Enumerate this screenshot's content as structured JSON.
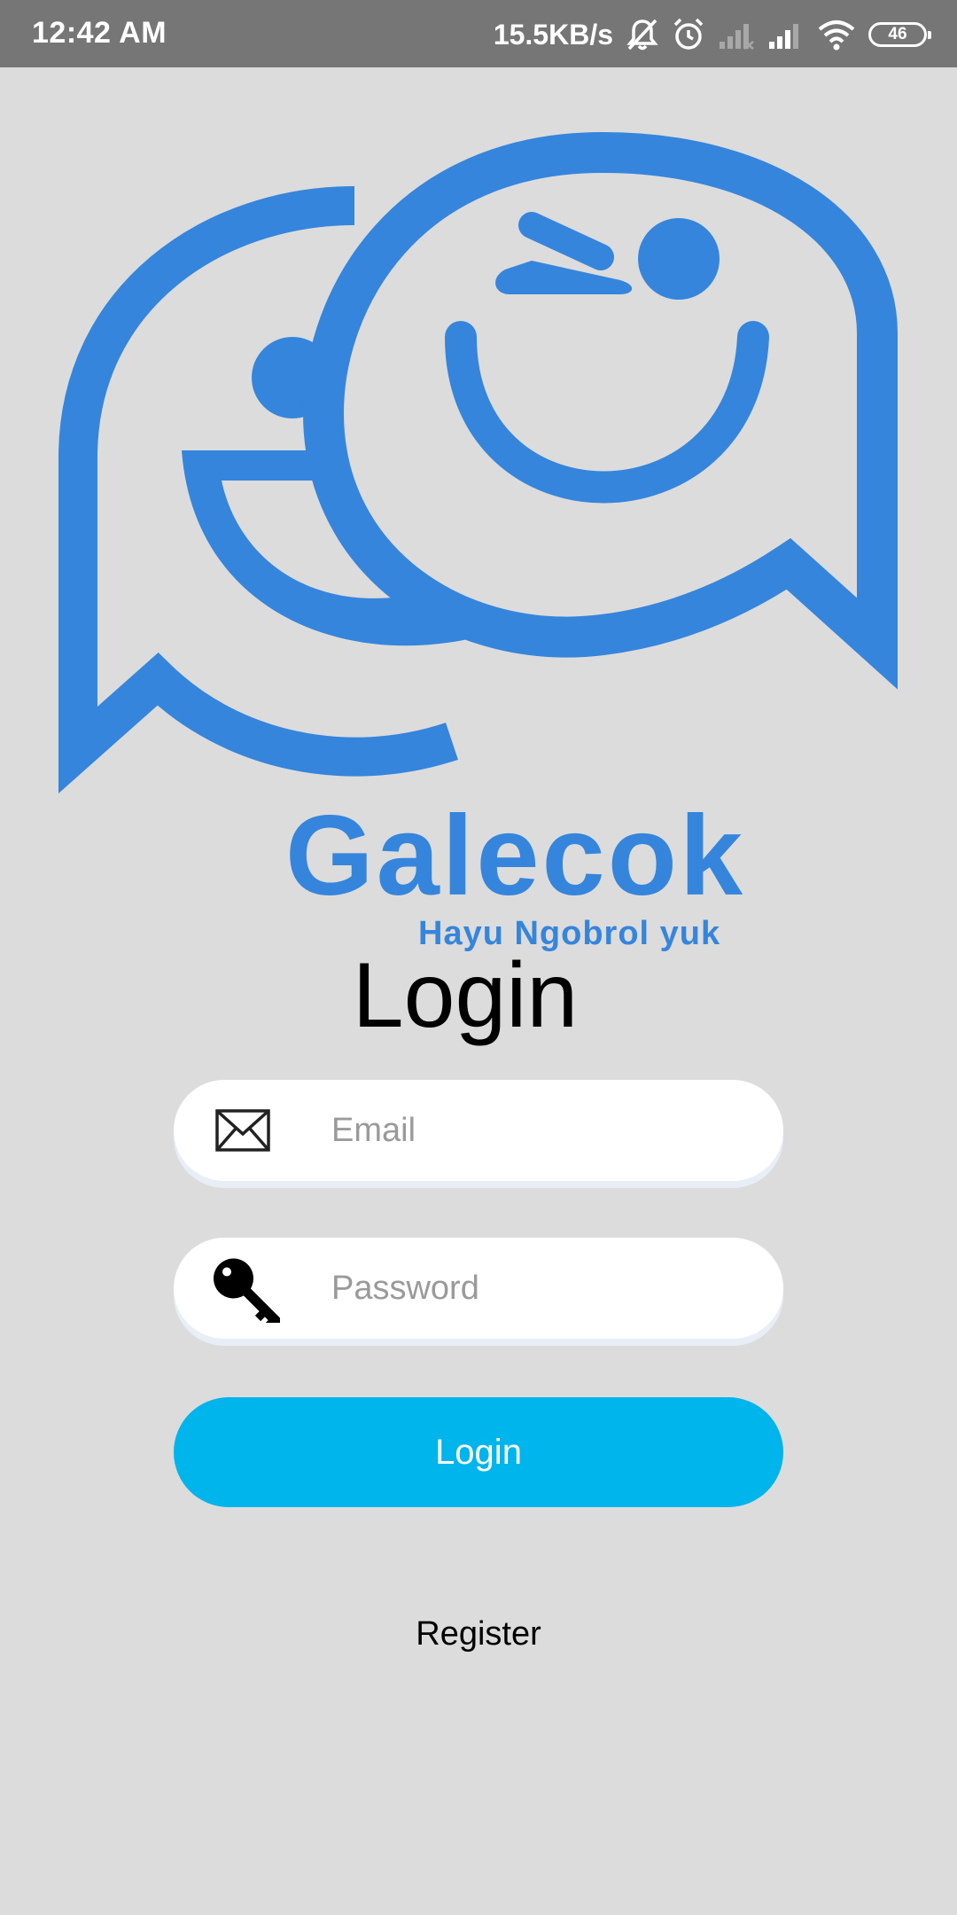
{
  "status_bar": {
    "time": "12:42 AM",
    "net_speed": "15.5KB/s",
    "battery": "46",
    "icons": [
      "bell-off-icon",
      "alarm-icon",
      "signal-icon",
      "signal-icon",
      "wifi-icon",
      "battery-icon"
    ]
  },
  "logo": {
    "name": "Galecok",
    "tagline": "Hayu Ngobrol yuk",
    "color": "#3585dc"
  },
  "login": {
    "title": "Login",
    "email_placeholder": "Email",
    "email_icon": "envelope-icon",
    "password_placeholder": "Password",
    "password_icon": "key-icon",
    "button_label": "Login",
    "button_color": "#00b4ec",
    "register_label": "Register"
  }
}
